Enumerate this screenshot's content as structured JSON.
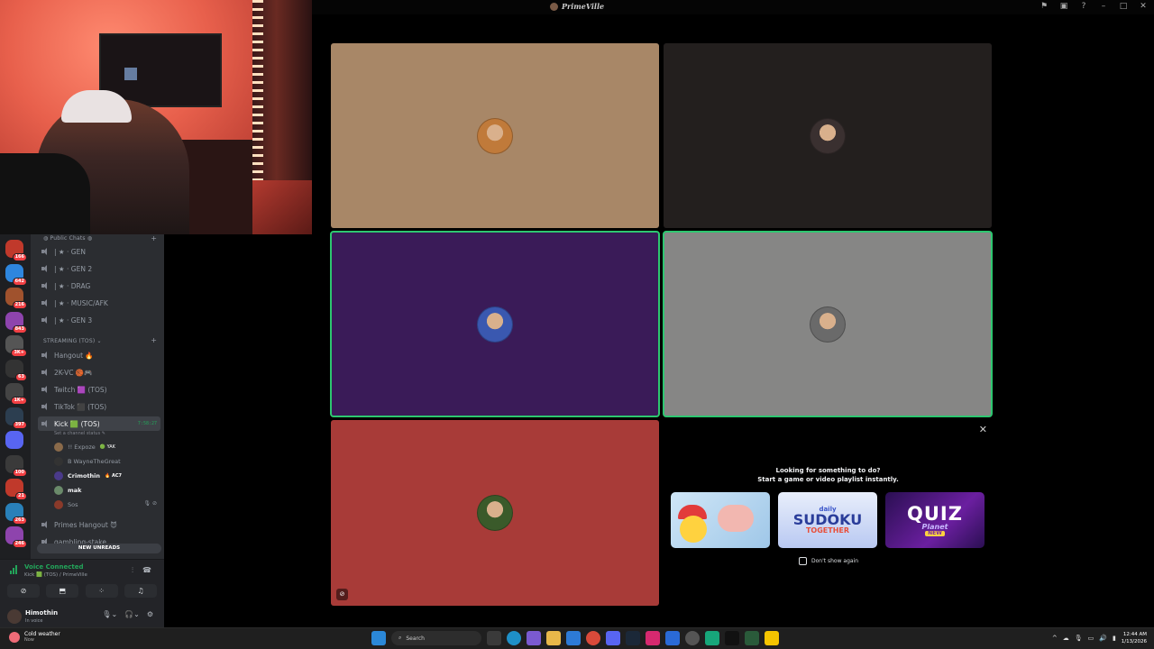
{
  "window": {
    "title": "PrimeVille"
  },
  "sidebar": {
    "servers": [
      {
        "badge": "166",
        "color": "#c0392b"
      },
      {
        "badge": "642",
        "color": "#2e86de"
      },
      {
        "badge": "216",
        "color": "#a0522d"
      },
      {
        "badge": "843",
        "color": "#8e44ad"
      },
      {
        "badge": "3K+",
        "color": "#555"
      },
      {
        "badge": "63",
        "color": "#333"
      },
      {
        "badge": "1K+",
        "color": "#444"
      },
      {
        "badge": "397",
        "color": "#2c3e50"
      },
      {
        "badge": "",
        "color": "#5865f2"
      },
      {
        "badge": "100",
        "color": "#3a3a3a"
      },
      {
        "badge": "21",
        "color": "#c0392b"
      },
      {
        "badge": "263",
        "color": "#2980b9"
      },
      {
        "badge": "246",
        "color": "#8e44ad"
      }
    ],
    "categories": {
      "public": "Public Chats",
      "streaming": "STREAMING (TOS)"
    },
    "public_channels": [
      "| ★ · GEN",
      "| ★ · GEN 2",
      "| ★ · DRAG",
      "| ★ · MUSIC/AFK",
      "| ★ · GEN 3"
    ],
    "streaming_channels": [
      "Hangout 🔥",
      "2K-VC 🏀🎮",
      "Twitch 🟪 (TOS)",
      "TikTok ⬛ (TOS)"
    ],
    "active_channel": {
      "name": "Kick 🟩 (TOS)",
      "timer": "7:58:27",
      "status": "Set a channel status ✎"
    },
    "members": [
      {
        "name": "!! Expoze",
        "tag": "🟢 YAK",
        "bold": false,
        "color": "#8a6a4a"
      },
      {
        "name": "B WayneTheGreat",
        "tag": "",
        "bold": false,
        "color": "#333"
      },
      {
        "name": "Crimothin",
        "tag": "🔥 AC7",
        "bold": true,
        "color": "#4a3a8a"
      },
      {
        "name": "mak",
        "tag": "",
        "bold": true,
        "color": "#6a8a6a"
      },
      {
        "name": "Sos",
        "tag": "",
        "bold": false,
        "color": "#8a3a2a"
      }
    ],
    "after_channels": [
      "Primes Hangout 😈",
      "gambling-stake"
    ],
    "new_unreads": "NEW UNREADS"
  },
  "voice": {
    "connected": "Voice Connected",
    "location": "Kick 🟩 (TOS) / PrimeVille"
  },
  "user": {
    "name": "Himothin",
    "status": "In voice"
  },
  "tiles": [
    {
      "color": "#a88767",
      "avatar": "#c07a3a",
      "speaking": false
    },
    {
      "color": "#231f1e",
      "avatar": "#3a3030",
      "speaking": false
    },
    {
      "color": "#3a1b58",
      "avatar": "#3a58b0",
      "speaking": true
    },
    {
      "color": "#868685",
      "avatar": "#6a6a6a",
      "speaking": true
    },
    {
      "color": "#a83b38",
      "avatar": "#3a5a2a",
      "speaking": false
    }
  ],
  "activity": {
    "heading1": "Looking for something to do?",
    "heading2": "Start a game or video playlist instantly.",
    "card2": {
      "l1": "daily",
      "l2": "SUDOKU",
      "l3": "TOGETHER"
    },
    "card3": {
      "l1": "QUIZ",
      "l2": "Planet",
      "l3": "NEW"
    },
    "dont_show": "Don't show again"
  },
  "taskbar": {
    "weather_title": "Cold weather",
    "weather_sub": "Now",
    "search": "Search",
    "time": "12:44 AM",
    "date": "1/13/2026"
  },
  "icons": [
    "flag-icon",
    "inbox-icon",
    "help-icon",
    "minimize-icon",
    "maximize-icon",
    "close-icon"
  ]
}
